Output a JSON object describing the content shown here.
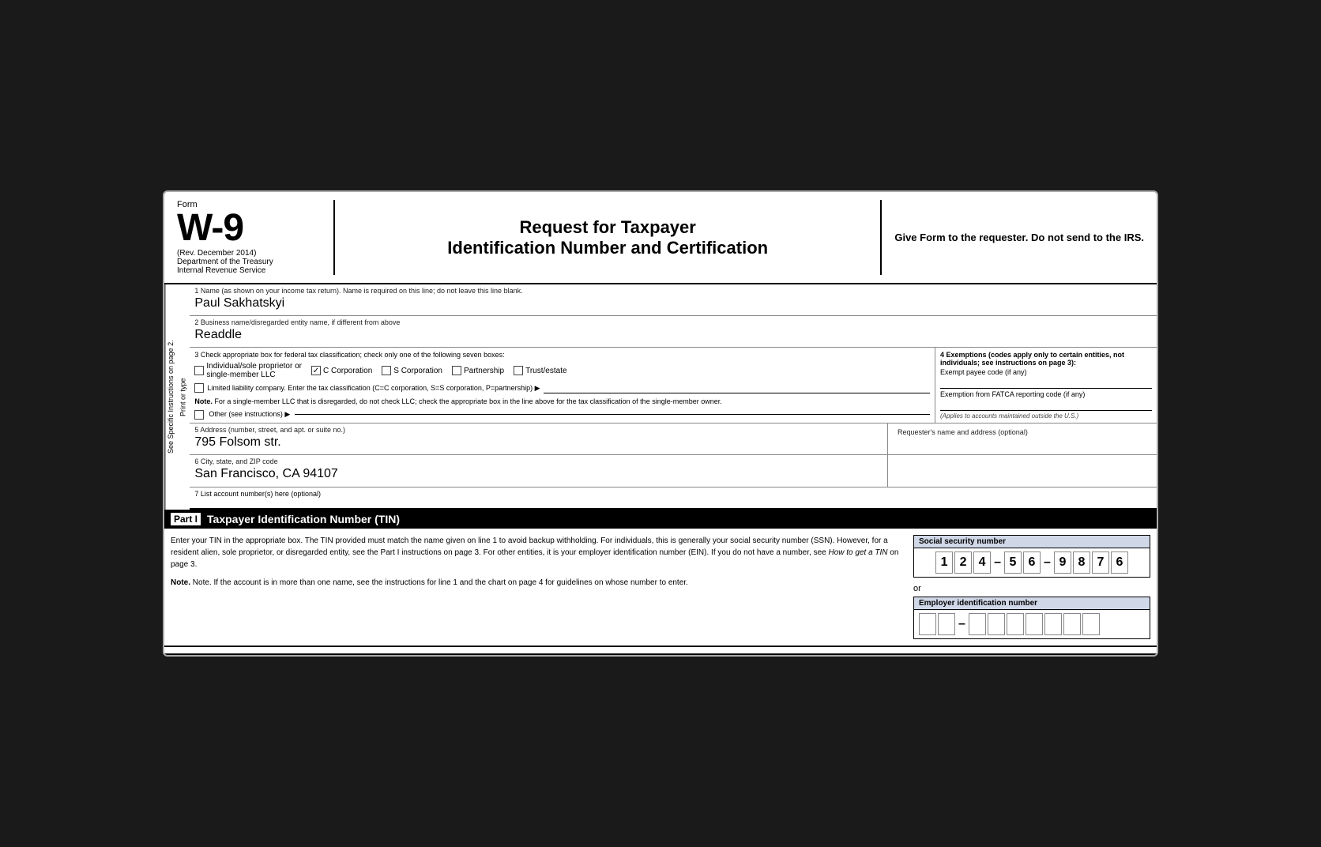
{
  "header": {
    "form_label": "Form",
    "form_number": "W-9",
    "rev": "(Rev. December 2014)",
    "dept1": "Department of the Treasury",
    "dept2": "Internal Revenue Service",
    "title_line1": "Request for Taxpayer",
    "title_line2": "Identification Number and Certification",
    "give_form_text": "Give Form to the requester. Do not send to the IRS."
  },
  "side_label": {
    "line1": "Print or type",
    "line2": "See Specific Instructions on page 2."
  },
  "field1": {
    "label": "1  Name (as shown on your income tax return). Name is required on this line; do not leave this line blank.",
    "value": "Paul Sakhatskyi"
  },
  "field2": {
    "label": "2  Business name/disregarded entity name, if different from above",
    "value": "Readdle"
  },
  "classification": {
    "header": "3  Check appropriate box for federal tax classification; check only one of the following seven boxes:",
    "options": [
      {
        "id": "individual",
        "label": "Individual/sole proprietor or single-member LLC",
        "checked": false
      },
      {
        "id": "c_corp",
        "label": "C Corporation",
        "checked": true
      },
      {
        "id": "s_corp",
        "label": "S Corporation",
        "checked": false
      },
      {
        "id": "partnership",
        "label": "Partnership",
        "checked": false
      },
      {
        "id": "trust",
        "label": "Trust/estate",
        "checked": false
      }
    ],
    "llc_text": "Limited liability company. Enter the tax classification (C=C corporation, S=S corporation, P=partnership) ▶",
    "note_text": "Note. For a single-member LLC that is disregarded, do not check LLC; check the appropriate box in the line above for the tax classification of the single-member owner.",
    "other_text": "Other (see instructions) ▶"
  },
  "exemptions": {
    "header": "4  Exemptions (codes apply only to certain entities, not individuals; see instructions on page 3):",
    "exempt_payee_label": "Exempt payee code (if any)",
    "fatca_label": "Exemption from FATCA reporting code (if any)",
    "applies_note": "(Applies to accounts maintained outside the U.S.)"
  },
  "field5": {
    "label": "5  Address (number, street, and apt. or suite no.)",
    "value": "795 Folsom str.",
    "requester_label": "Requester's name and address (optional)"
  },
  "field6": {
    "label": "6  City, state, and ZIP code",
    "value": "San Francisco, CA 94107"
  },
  "field7": {
    "label": "7  List account number(s) here (optional)"
  },
  "part_i": {
    "label": "Part I",
    "title": "Taxpayer Identification Number (TIN)",
    "instructions": "Enter your TIN in the appropriate box. The TIN provided must match the name given on line 1 to avoid backup withholding. For individuals, this is generally your social security number (SSN). However, for a resident alien, sole proprietor, or disregarded entity, see the Part I instructions on page 3. For other entities, it is your employer identification number (EIN). If you do not have a number, see",
    "how_to": "How to get a TIN",
    "on_page3": "on page 3.",
    "note_text": "Note. If the account is in more than one name, see the instructions for line 1 and the chart on page 4 for guidelines on whose number to enter.",
    "ssn_label": "Social security number",
    "ssn_digits": [
      "1",
      "2",
      "4",
      "",
      "5",
      "6",
      "",
      "9",
      "8",
      "7",
      "6"
    ],
    "or_text": "or",
    "ein_label": "Employer identification number",
    "ein_digits": [
      "",
      "",
      "",
      "",
      "",
      "",
      "",
      "",
      ""
    ]
  }
}
